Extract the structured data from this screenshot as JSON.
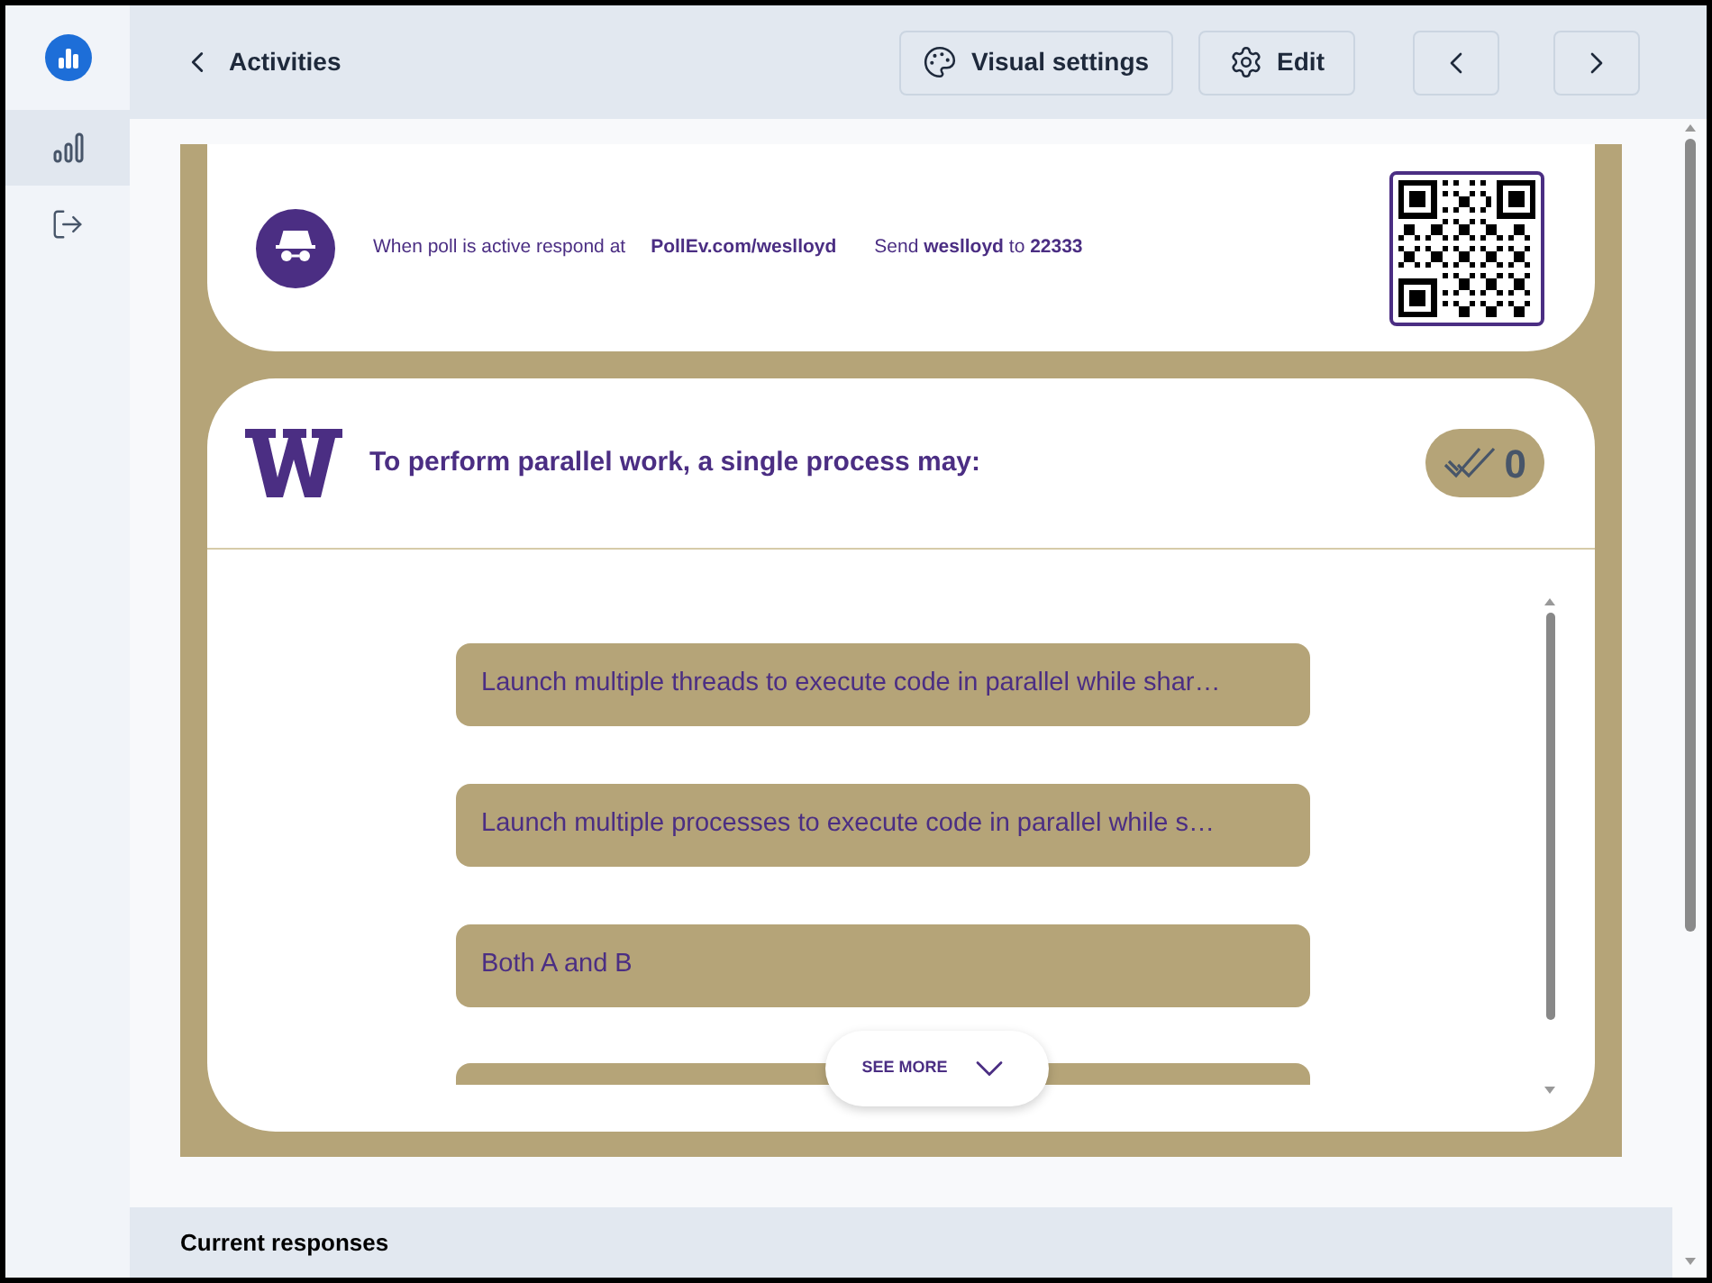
{
  "sidebar": {
    "items": [
      {
        "kind": "chart",
        "selected": true
      },
      {
        "kind": "logout",
        "selected": false
      }
    ]
  },
  "toolbar": {
    "back": "Activities",
    "buttons": [
      {
        "kind": "palette",
        "label": "Visual settings"
      },
      {
        "kind": "gear",
        "label": "Edit"
      },
      {
        "kind": "prev"
      },
      {
        "kind": "next"
      }
    ]
  },
  "poll_header": {
    "instruction": "When poll is active respond at",
    "url": "PollEv.com/weslloyd",
    "sms": "Send **weslloyd** to **22333**"
  },
  "question": {
    "title": "To perform parallel work, a single process may:",
    "response_count": "0",
    "options": [
      {
        "text": "Launch multiple threads to execute code in parallel while shar…"
      },
      {
        "text": "Launch multiple processes to execute code in parallel while s…"
      },
      {
        "text": "Both A and B"
      }
    ],
    "see_more": "SEE MORE"
  },
  "bottom_panel": {
    "title": "Current responses"
  }
}
